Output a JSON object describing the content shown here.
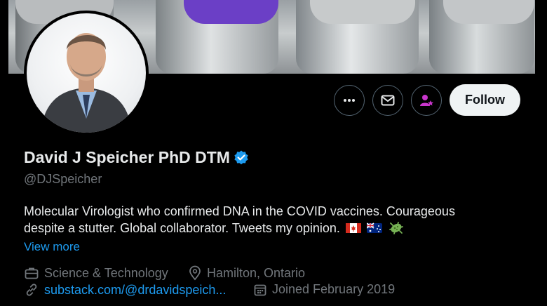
{
  "profile": {
    "name": "David J Speicher PhD DTM",
    "handle": "@DJSpeicher",
    "bio_line1": "Molecular Virologist who confirmed DNA in the COVID vaccines. Courageous",
    "bio_line2": "despite a stutter. Global collaborator. Tweets my opinion.",
    "view_more": "View more",
    "category": "Science & Technology",
    "location": "Hamilton, Ontario",
    "website": "substack.com/@drdavidspeich...",
    "joined": "Joined February 2019",
    "verified": true
  },
  "actions": {
    "more": "more-options-icon",
    "message": "envelope-icon",
    "subscribe": "person-star-icon",
    "follow_label": "Follow"
  },
  "banner": {
    "content": "vaccine vials photo"
  },
  "colors": {
    "background": "#000000",
    "primary_text": "#e7e9ea",
    "secondary_text": "#71767b",
    "link": "#1d9bf0",
    "verified": "#1d9bf0",
    "subscribe_icon": "#c936cc",
    "follow_bg": "#eff3f4"
  }
}
